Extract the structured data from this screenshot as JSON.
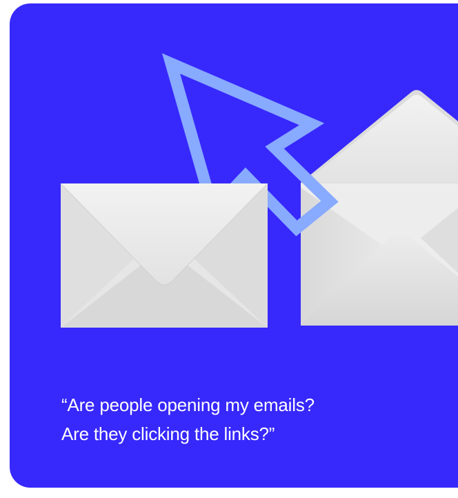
{
  "theme": {
    "card_background": "#3728fb",
    "cursor_color": "#88aaff",
    "envelope_color": "#e4e4e4"
  },
  "quote": {
    "line1": "“Are people opening my emails?",
    "line2": "Are they clicking the links?”"
  },
  "icons": {
    "cursor": "arrow-cursor-icon",
    "closed_envelope": "closed-envelope-icon",
    "open_envelope": "open-envelope-icon"
  }
}
